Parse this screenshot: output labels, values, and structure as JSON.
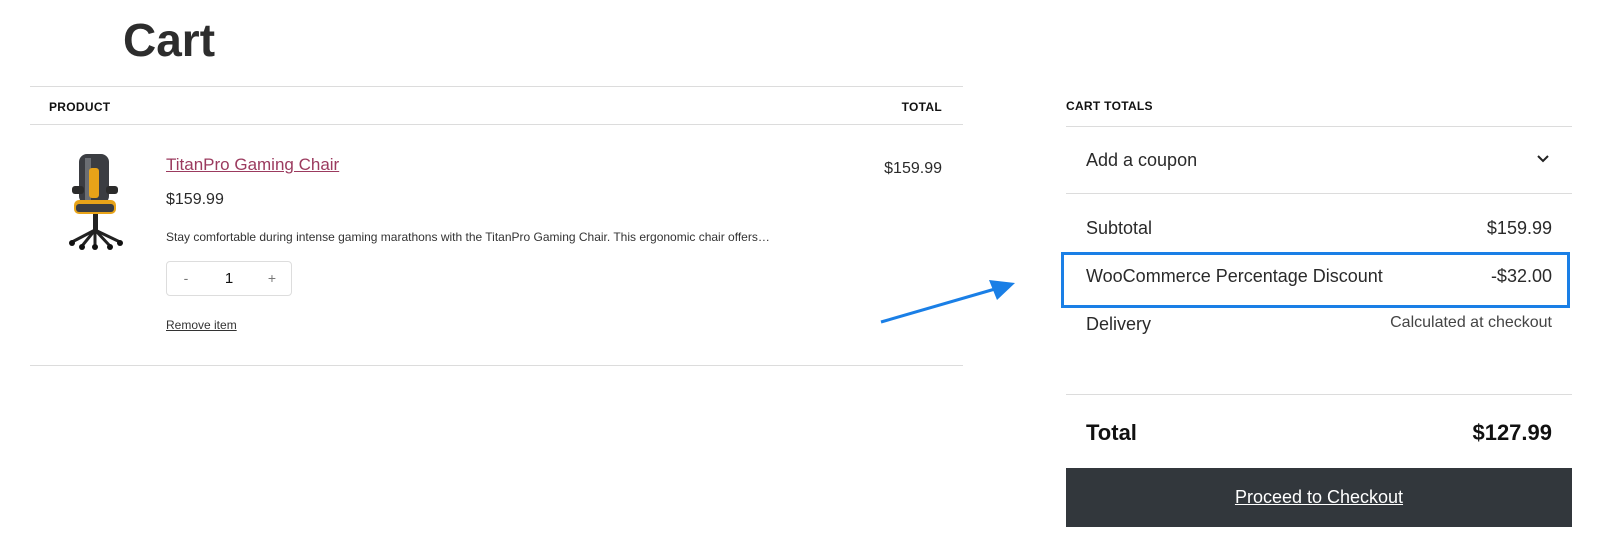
{
  "page": {
    "title": "Cart"
  },
  "cart_table": {
    "col_product": "PRODUCT",
    "col_total": "TOTAL",
    "items": [
      {
        "name": "TitanPro Gaming Chair",
        "price": "$159.99",
        "description": "Stay comfortable during intense gaming marathons with the TitanPro Gaming Chair. This ergonomic chair offers…",
        "quantity": "1",
        "decrement": "-",
        "increment": "+",
        "remove_label": "Remove item",
        "line_total": "$159.99",
        "image_icon": "gaming-chair"
      }
    ]
  },
  "totals": {
    "heading": "CART TOTALS",
    "coupon_label": "Add a coupon",
    "subtotal_label": "Subtotal",
    "subtotal_value": "$159.99",
    "discount_label": "WooCommerce Percentage Discount",
    "discount_value": "-$32.00",
    "delivery_label": "Delivery",
    "delivery_value": "Calculated at checkout",
    "total_label": "Total",
    "total_value": "$127.99",
    "checkout_label": "Proceed to Checkout"
  },
  "annotation": {
    "arrow_color": "#1a7fe6",
    "highlight_color": "#1a7fe6"
  },
  "colors": {
    "accent_link": "#9b3a5e",
    "button_bg": "#32373c"
  }
}
